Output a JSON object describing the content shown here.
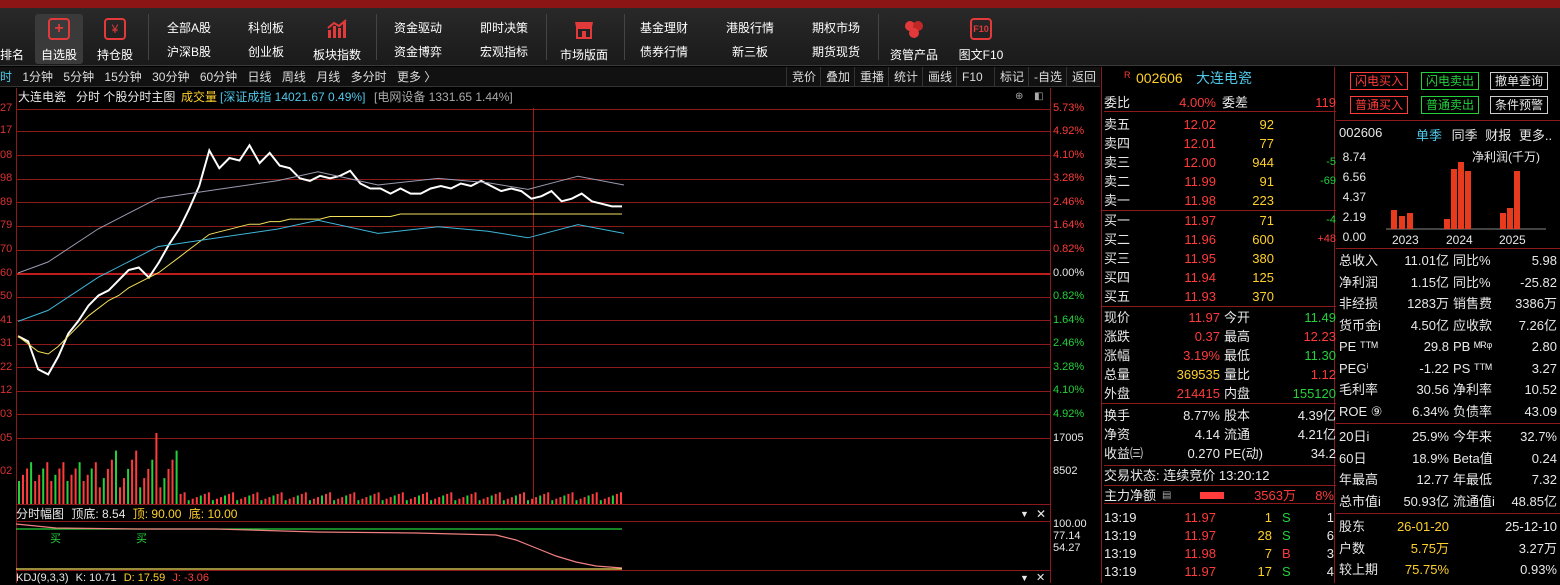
{
  "toolbar": {
    "items": [
      {
        "label": "排名"
      },
      {
        "label": "自选股"
      },
      {
        "label": "持仓股"
      },
      {
        "top": "全部A股",
        "bottom": "沪深B股"
      },
      {
        "top": "科创板",
        "bottom": "创业板"
      },
      {
        "label": "板块指数"
      },
      {
        "top": "资金驱动",
        "bottom": "资金博弈"
      },
      {
        "top": "即时决策",
        "bottom": "宏观指标"
      },
      {
        "label": "市场版面"
      },
      {
        "top": "基金理财",
        "bottom": "债券行情"
      },
      {
        "top": "港股行情",
        "bottom": "新三板"
      },
      {
        "top": "期权市场",
        "bottom": "期货现货"
      },
      {
        "label": "资管产品"
      },
      {
        "label": "图文F10",
        "icon_text": "F10"
      }
    ]
  },
  "periods": [
    "时",
    "1分钟",
    "5分钟",
    "15分钟",
    "30分钟",
    "60分钟",
    "日线",
    "周线",
    "月线",
    "多分时",
    "更多 〉"
  ],
  "right_tools": [
    "竞价",
    "叠加",
    "重播",
    "统计",
    "画线",
    "F10",
    "标记",
    "-自选",
    "返回"
  ],
  "chart_head": {
    "name": "大连电瓷",
    "mode": "分时 个股分时主图",
    "vol": "成交量",
    "index": "[深证成指 14021.67 0.49%]",
    "sector": "[电网设备 1331.65 1.44%]"
  },
  "left_axis": [
    "27",
    "17",
    "08",
    "98",
    "89",
    "79",
    "70",
    "60",
    "50",
    "41",
    "31",
    "22",
    "12",
    "03",
    "05",
    "02"
  ],
  "right_axis": [
    "5.73%",
    "4.92%",
    "4.10%",
    "3.28%",
    "2.46%",
    "1.64%",
    "0.82%",
    "0.00%",
    "0.82%",
    "1.64%",
    "2.46%",
    "3.28%",
    "4.10%",
    "4.92%",
    "17005",
    "8502"
  ],
  "indicator1": {
    "title": "分时幅图",
    "l1": "顶底: 8.54",
    "l2": "顶: 90.00",
    "l3": "底: 10.00",
    "ticks": [
      "100.00",
      "77.14",
      "54.27"
    ],
    "tag": "买"
  },
  "indicator2": {
    "title": "KDJ(9,3,3)",
    "k": "K: 10.71",
    "d": "D: 17.59",
    "j": "J: -3.06"
  },
  "stock": {
    "flag": "R",
    "code": "002606",
    "name": "大连电瓷"
  },
  "quote": {
    "webi_label": "委比",
    "webi": "4.00%",
    "weicha_label": "委差",
    "weicha": "119",
    "sells": [
      {
        "label": "卖五",
        "price": "12.02",
        "vol": "92",
        "chg": ""
      },
      {
        "label": "卖四",
        "price": "12.01",
        "vol": "77",
        "chg": ""
      },
      {
        "label": "卖三",
        "price": "12.00",
        "vol": "944",
        "chg": "-5"
      },
      {
        "label": "卖二",
        "price": "11.99",
        "vol": "91",
        "chg": "-69"
      },
      {
        "label": "卖一",
        "price": "11.98",
        "vol": "223",
        "chg": ""
      }
    ],
    "buys": [
      {
        "label": "买一",
        "price": "11.97",
        "vol": "71",
        "chg": "-4"
      },
      {
        "label": "买二",
        "price": "11.96",
        "vol": "600",
        "chg": "+48"
      },
      {
        "label": "买三",
        "price": "11.95",
        "vol": "380",
        "chg": ""
      },
      {
        "label": "买四",
        "price": "11.94",
        "vol": "125",
        "chg": ""
      },
      {
        "label": "买五",
        "price": "11.93",
        "vol": "370",
        "chg": ""
      }
    ],
    "stats": [
      {
        "l1": "现价",
        "v1": "11.97",
        "c1": "red",
        "l2": "今开",
        "v2": "11.49",
        "c2": "green"
      },
      {
        "l1": "涨跌",
        "v1": "0.37",
        "c1": "red",
        "l2": "最高",
        "v2": "12.23",
        "c2": "red"
      },
      {
        "l1": "涨幅",
        "v1": "3.19%",
        "c1": "red",
        "l2": "最低",
        "v2": "11.30",
        "c2": "green"
      },
      {
        "l1": "总量",
        "v1": "369535",
        "c1": "yellow",
        "l2": "量比",
        "v2": "1.12",
        "c2": "red"
      },
      {
        "l1": "外盘",
        "v1": "214415",
        "c1": "red",
        "l2": "内盘",
        "v2": "155120",
        "c2": "green"
      },
      {
        "l1": "换手",
        "v1": "8.77%",
        "c1": "white",
        "l2": "股本",
        "v2": "4.39亿",
        "c2": "white"
      },
      {
        "l1": "净资",
        "v1": "4.14",
        "c1": "white",
        "l2": "流通",
        "v2": "4.21亿",
        "c2": "white"
      },
      {
        "l1": "收益㈢",
        "v1": "0.270",
        "c1": "white",
        "l2": "PE(动)",
        "v2": "34.2",
        "c2": "white"
      }
    ],
    "trade_status": "交易状态: 连续竞价 13:20:12",
    "main_flow_label": "主力净额",
    "main_flow": "3563万",
    "main_flow_pct": "8%",
    "ticks": [
      {
        "time": "13:19",
        "price": "11.97",
        "vol": "1",
        "side": "S",
        "n": "1"
      },
      {
        "time": "13:19",
        "price": "11.97",
        "vol": "28",
        "side": "S",
        "n": "6"
      },
      {
        "time": "13:19",
        "price": "11.98",
        "vol": "7",
        "side": "B",
        "n": "3"
      },
      {
        "time": "13:19",
        "price": "11.97",
        "vol": "17",
        "side": "S",
        "n": "4"
      }
    ]
  },
  "actions": [
    "闪电买入",
    "闪电卖出",
    "撤单查询",
    "普通买入",
    "普通卖出",
    "条件预警"
  ],
  "fin": {
    "code": "002606",
    "tabs": [
      "单季",
      "同季",
      "财报",
      "更多.."
    ],
    "chart_title": "净利润(千万)",
    "y_ticks": [
      "8.74",
      "6.56",
      "4.37",
      "2.19",
      "0.00"
    ],
    "x_ticks": [
      "2023",
      "2024",
      "2025"
    ],
    "rows": [
      {
        "l1": "总收入",
        "v1": "11.01亿",
        "l2": "同比%",
        "v2": "5.98"
      },
      {
        "l1": "净利润",
        "v1": "1.15亿",
        "l2": "同比%",
        "v2": "-25.82"
      },
      {
        "l1": "非经损",
        "v1": "1283万",
        "l2": "销售费",
        "v2": "3386万"
      },
      {
        "l1": "货币金i",
        "v1": "4.50亿",
        "l2": "应收款",
        "v2": "7.26亿"
      },
      {
        "l1": "PE ᵀᵀᴹ",
        "v1": "29.8",
        "l2": "PB ᴹᴿᵠ",
        "v2": "2.80"
      },
      {
        "l1": "PEGⁱ",
        "v1": "-1.22",
        "l2": "PS ᵀᵀᴹ",
        "v2": "3.27"
      },
      {
        "l1": "毛利率",
        "v1": "30.56",
        "l2": "净利率",
        "v2": "10.52"
      },
      {
        "l1": "ROE ⑨",
        "v1": "6.34%",
        "l2": "负债率",
        "v2": "43.09"
      },
      {
        "l1": "20日i",
        "v1": "25.9%",
        "l2": "今年来",
        "v2": "32.7%"
      },
      {
        "l1": "60日",
        "v1": "18.9%",
        "l2": "Beta值",
        "v2": "0.24"
      },
      {
        "l1": "年最高",
        "v1": "12.77",
        "l2": "年最低",
        "v2": "7.32"
      },
      {
        "l1": "总市值i",
        "v1": "50.93亿",
        "l2": "流通值i",
        "v2": "48.85亿"
      },
      {
        "l1": "股东",
        "v1": "26-01-20",
        "l2": "",
        "v2": "25-12-10"
      },
      {
        "l1": "户数",
        "v1": "5.75万",
        "l2": "",
        "v2": "3.27万"
      },
      {
        "l1": "较上期",
        "v1": "75.75%",
        "l2": "",
        "v2": "0.93%"
      }
    ]
  },
  "chart_data": [
    {
      "type": "line",
      "series": [
        {
          "values": [
            11.46,
            11.44,
            11.33,
            11.31,
            11.38,
            11.47,
            11.52,
            11.58,
            11.62,
            11.64,
            11.68,
            11.72,
            11.73,
            11.69,
            11.75,
            11.82,
            11.88,
            11.96,
            12.05,
            12.19,
            12.12,
            12.16,
            12.15,
            12.21,
            12.14,
            12.18,
            12.13,
            12.12,
            12.08,
            12.07,
            12.09,
            12.08,
            12.09,
            12.11,
            12.06,
            12.04,
            12.04,
            12.02,
            12.04,
            12.02,
            12.02,
            12.04,
            12.05,
            12.04,
            12.06,
            12.05,
            12.07,
            12.05,
            12.03,
            12.04,
            12.03,
            12.0,
            12.01,
            12.03,
            11.99,
            12.0,
            12.02,
            11.99,
            11.98,
            11.97,
            11.97
          ]
        },
        {
          "values": [
            11.46,
            11.43,
            11.4,
            11.39,
            11.42,
            11.46,
            11.5,
            11.54,
            11.57,
            11.6,
            11.62,
            11.65,
            11.67,
            11.69,
            11.71,
            11.74,
            11.77,
            11.8,
            11.83,
            11.86,
            11.87,
            11.88,
            11.89,
            11.9,
            11.9,
            11.91,
            11.91,
            11.92,
            11.92,
            11.92,
            11.92,
            11.93,
            11.93,
            11.93,
            11.93,
            11.93,
            11.93,
            11.93,
            11.94,
            11.94,
            11.94,
            11.94,
            11.94,
            11.94,
            11.94,
            11.94,
            11.94,
            11.94,
            11.94,
            11.94,
            11.94,
            11.94,
            11.94,
            11.94,
            11.94,
            11.94,
            11.94,
            11.94,
            11.94,
            11.94,
            11.94
          ]
        }
      ],
      "ylim": [
        11.06,
        12.27
      ]
    },
    {
      "type": "bar",
      "ylim": [
        0,
        17005
      ]
    }
  ]
}
